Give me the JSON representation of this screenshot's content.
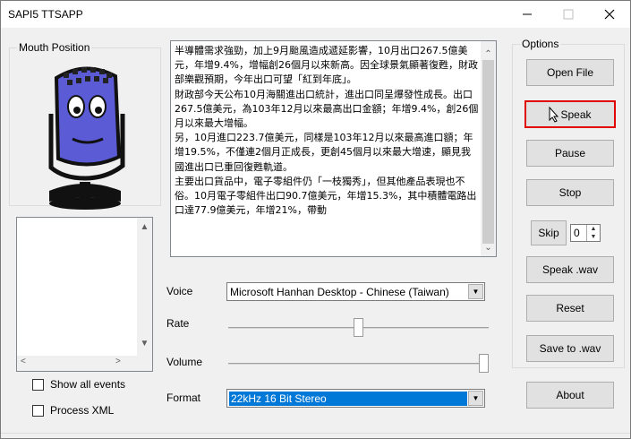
{
  "window": {
    "title": "SAPI5 TTSAPP"
  },
  "mouth_group": {
    "label": "Mouth Position"
  },
  "options_group": {
    "label": "Options"
  },
  "buttons": {
    "open_file": "Open File",
    "speak": "Speak",
    "pause": "Pause",
    "stop": "Stop",
    "skip": "Skip",
    "speak_wav": "Speak .wav",
    "reset": "Reset",
    "save_wav": "Save to .wav",
    "about": "About"
  },
  "skip_value": "0",
  "text_content": "半導體需求強勁，加上9月颱風造成遞延影響，10月出口267.5億美元，年增9.4%，增幅創26個月以來新高。因全球景氣顯著復甦，財政部樂觀預期，今年出口可望「紅到年底」。\n財政部今天公布10月海關進出口統計，進出口同呈爆發性成長。出口267.5億美元，為103年12月以來最高出口金額；年增9.4%，創26個月以來最大增幅。\n另，10月進口223.7億美元，同樣是103年12月以來最高進口額；年增19.5%，不僅連2個月正成長，更創45個月以來最大增速，顯見我國進出口已重回復甦軌道。\n主要出口貨品中，電子零組件仍「一枝獨秀」，但其他產品表現也不俗。10月電子零組件出口90.7億美元，年增15.3%，其中積體電路出口達77.9億美元，年增21%，帶動",
  "voice": {
    "label": "Voice",
    "value": "Microsoft Hanhan Desktop - Chinese (Taiwan)"
  },
  "rate": {
    "label": "Rate",
    "level": 0.5
  },
  "volume": {
    "label": "Volume",
    "level": 1.0
  },
  "format": {
    "label": "Format",
    "value": "22kHz 16 Bit Stereo"
  },
  "checkboxes": {
    "show_all_events": "Show all events",
    "process_xml": "Process XML"
  },
  "colors": {
    "highlight_border": "#e00000",
    "selection": "#0078d7",
    "face": "#5b5bd6"
  }
}
